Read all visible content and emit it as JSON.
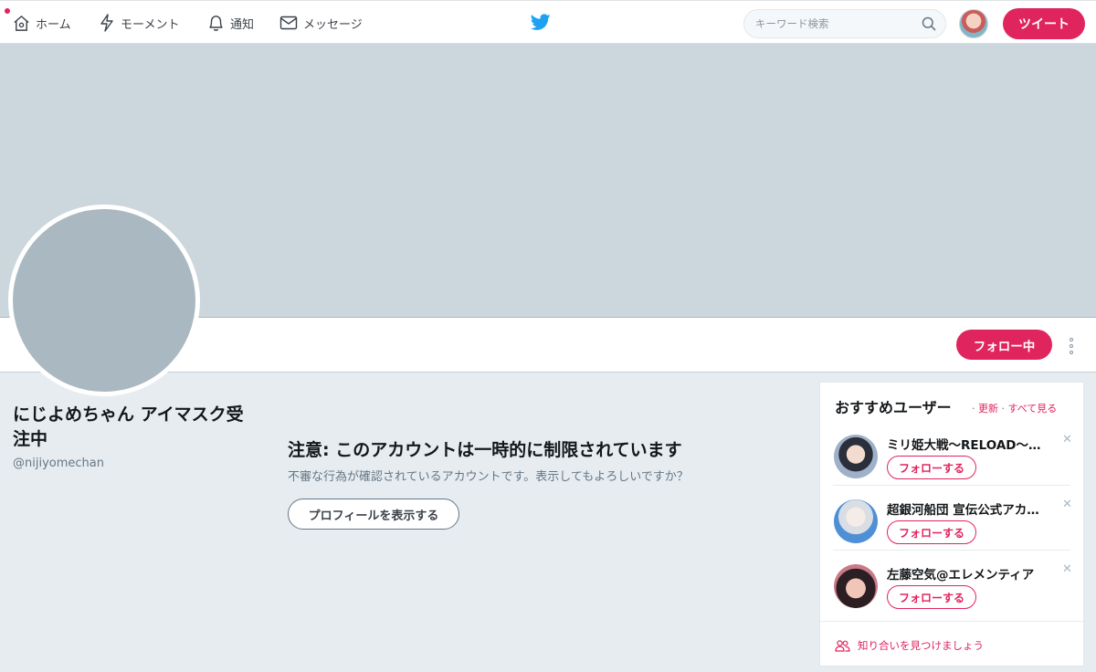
{
  "nav": {
    "home": "ホーム",
    "moments": "モーメント",
    "notifications": "通知",
    "messages": "メッセージ",
    "search_placeholder": "キーワード検索",
    "tweet": "ツイート"
  },
  "profile": {
    "display_name": "にじよめちゃん アイマスク受注中",
    "handle": "@nijiyomechan",
    "follow_button": "フォロー中"
  },
  "warning": {
    "title": "注意: このアカウントは一時的に制限されています",
    "text": "不審な行為が確認されているアカウントです。表示してもよろしいですか？",
    "button": "プロフィールを表示する"
  },
  "who_to_follow": {
    "title": "おすすめユーザー",
    "refresh": "更新",
    "view_all": "すべて見る",
    "users": [
      {
        "name": "ミリ姫大戦～RELOAD～公式",
        "follow": "フォローする"
      },
      {
        "name": "超銀河船団 宣伝公式アカウント",
        "follow": "フォローする"
      },
      {
        "name": "左藤空気@エレメンティア",
        "follow": "フォローする"
      }
    ],
    "find_friends": "知り合いを見つけましょう"
  },
  "colors": {
    "accent": "#e0245e",
    "banner": "#ccd6dd",
    "avatar_placeholder": "#aab8c2",
    "twitter_blue": "#1da1f2"
  }
}
